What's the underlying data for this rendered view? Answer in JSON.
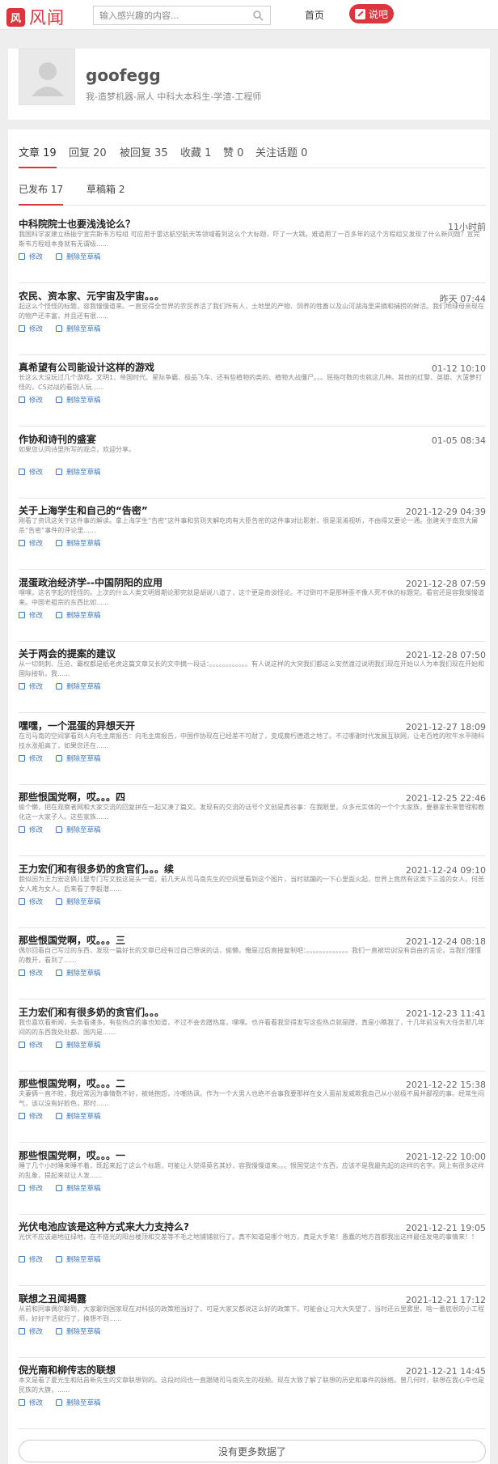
{
  "header": {
    "logo_badge": "风",
    "logo_text": "风闻",
    "search_placeholder": "输入感兴趣的内容...",
    "nav_home": "首页",
    "post_button": "说吧"
  },
  "profile": {
    "username": "goofegg",
    "bio": "我-造梦机器-屌人 中科大本科生-学渣-工程师"
  },
  "tabs": [
    {
      "label": "文章 19"
    },
    {
      "label": "回复 20"
    },
    {
      "label": "被回复 35"
    },
    {
      "label": "收藏 1"
    },
    {
      "label": "赞 0"
    },
    {
      "label": "关注话题 0"
    }
  ],
  "subtabs": [
    {
      "label": "已发布 17"
    },
    {
      "label": "草稿箱 2"
    }
  ],
  "action_labels": {
    "edit": "修改",
    "delete": "删除至草稿"
  },
  "articles": [
    {
      "title": "中科院院士也要浅浅论么？",
      "time": "11小时前",
      "excerpt": "我国科学家建立杨振宁宣完斯韦方程组 可应用于雷达航空航天等领域看到这么个大标题，吓了一大跳。难道用了一百多年的这个方程组又发现了什么新问题？宣完斯韦方程组本身就有无谓极......"
    },
    {
      "title": "农民、资本家、元宇宙及宇宙。。。",
      "time": "昨天 07:44",
      "excerpt": "起这么个怪怪的标题，容我慢慢道来。一直觉得全世界的农民养活了我们所有人，土地里的产物、饲养的牲畜以及山河湖海里采摘和捕捞的鲜活。我们地球母亲现在的物产还丰富，并且还有很......"
    },
    {
      "title": "真希望有公司能设计这样的游戏",
      "time": "01-12 10:10",
      "excerpt": "长这么大没玩过几个游戏。文明1、帝国时代、星际争霸、极品飞车、还有些植物的类的、植物大战僵尸。。。屈指可数的也就这几种。其他的红警、英雄、大菠萝打怪的，CS对战的看别人玩......"
    },
    {
      "title": "作协和诗刊的盛宴",
      "time": "01-05 08:34",
      "excerpt": "如果您认同诗里所写的观点，欢迎分享。"
    },
    {
      "title": "关于上海学生和自己的“告密”",
      "time": "2021-12-29 04:39",
      "excerpt": "刚看了资讯这关于这件事的解读。拿上海学生“告密”这件事和贫则天解吃肉有大臣告密的这件事对比影射，很是混淆视听，不由得又要论一通。张建关于南京大屠杀“告密”事件的评论里......"
    },
    {
      "title": "混蛋政治经济学--中国阴阳的应用",
      "time": "2021-12-28 07:59",
      "excerpt": "嘿嘿，这名字起的怪怪的。上次的什么人类文明周期论那完就是胡说八道了，这个更是奇谈怪论。不过倒可不是那种歪不像人死不休的标题党。看官还是容我慢慢道来。中国老祖宗的东西比如......"
    },
    {
      "title": "关于两会的提案的建议",
      "time": "2021-12-28 07:50",
      "excerpt": "从一切刺刺、压迫、霸权都是纸老虎这篇文章又长的文中摘一段话：。。。。。。。。。。。。有人说这样的大突我们都这么安然渡过说明我们现在开始以人为本我们现在开始和国际接轨，我......"
    },
    {
      "title": "嘿嘿，一个混蛋的异想天开",
      "time": "2021-12-27 18:09",
      "excerpt": "在司马南的空间掌看到人向毛主席报告：向毛主席报告，中国作协现在已经差不可耐了，变成腐朽德遗之地了。不过哪谢时代发展互联网，让老百姓的吹牛水平随科技水涨船高了，如果您还在......"
    },
    {
      "title": "那些恨国党啊，哎。。。四",
      "time": "2021-12-25 22:46",
      "excerpt": "偷个懒，把在观察者网和大家交流的回复拼在一起又凑了篇文。发现有的交流的话号个文创是真谷事：在我眼里，众多元实体的一个个大家族，要暴家长来管理和教化这一大家子人。这些家族......"
    },
    {
      "title": "王力宏们和有很多奶的贪官们。。。续",
      "time": "2021-12-24 09:10",
      "excerpt": "貌似因为王力宏这俩儿娶专门写文脱这是头一道，前几天从司马南先生的空间里看到这个图片，当时就蹦的一下心里面火起，世界上竟然有这类下三滥的女人，何苦女人难为女人。后来看了李毅潜......"
    },
    {
      "title": "那些恨国党啊，哎。。。三",
      "time": "2021-12-24 08:18",
      "excerpt": "偶尔回看自己写过的东西，发现一篇好长的文章已经有过自己想说的话，偷懒，俺是过后直接复制吧：。。。。。。。。。。。。。我们一直被培训没有自由的言论，当我们懂懂的教开，看到了......"
    },
    {
      "title": "王力宏们和有很多奶的贪官们。。。",
      "time": "2021-12-23 11:41",
      "excerpt": "我也喜欢看新闻，头条看诸多，有些热点的事也知道，不过不会去蹭热度，嘿嘿。也许看看我觉得发写这些热点就是蹭，真是小瞧我了，十几年前没有大任务那几年间的的东西我处处都，国内是......"
    },
    {
      "title": "那些恨国党啊，哎。。。二",
      "time": "2021-12-22 15:38",
      "excerpt": "夫妻俩一直不睦，我经常因为事情数不好，被她抱怨，冷嘲热讽。作为一个大男人也绝不会事我要那样在女人面前发威欺我自己从小就极不屑并鄙视的事。经常生闷气，该以没有好脸色，那时......"
    },
    {
      "title": "那些恨国党啊，哎。。。一",
      "time": "2021-12-22 10:00",
      "excerpt": "睡了几个小时睡来睡不着，既起来起了这么个标题，可能让人觉得莫名其妙，容我慢慢道来。。。恨国党这个东西，应该不是我最先起的这样的名字。网上有很多这样的乱象，提起来就让人发......"
    },
    {
      "title": "光伏电池应该是这种方式来大力支持么?",
      "time": "2021-12-21 19:05",
      "excerpt": "光伏不应该遍地征绿地，在不搭光的阳台楼顶和交差等不毛之地铺铺就行了。真不知道是哪个地方，真是大手笔！愚蠢的地方首都我出这样最佳发电的事情来！！"
    },
    {
      "title": "联想之丑闻揭露",
      "time": "2021-12-21 17:12",
      "excerpt": "从前和同事偶尔聊到，大家聊到国家现在对科技的政策相当好了，可是大家又都说这么好的政策下，可能会让习大大失望了，当时还云里雾里，啥一番底很的小工程师，好好干活就行了，换想不到......"
    },
    {
      "title": "倪光南和柳传志的联想",
      "time": "2021-12-21 14:45",
      "excerpt": "本文是看了夏光生和陆昌新先生的文章联想到的。这段时间也一直跟随司马南先生的视频。现在大致了解了联想的历史和事件的脉络。曾几何时，联想在我心中也是民族的大旗，......"
    }
  ],
  "footer": {
    "no_more": "没有更多数据了"
  }
}
